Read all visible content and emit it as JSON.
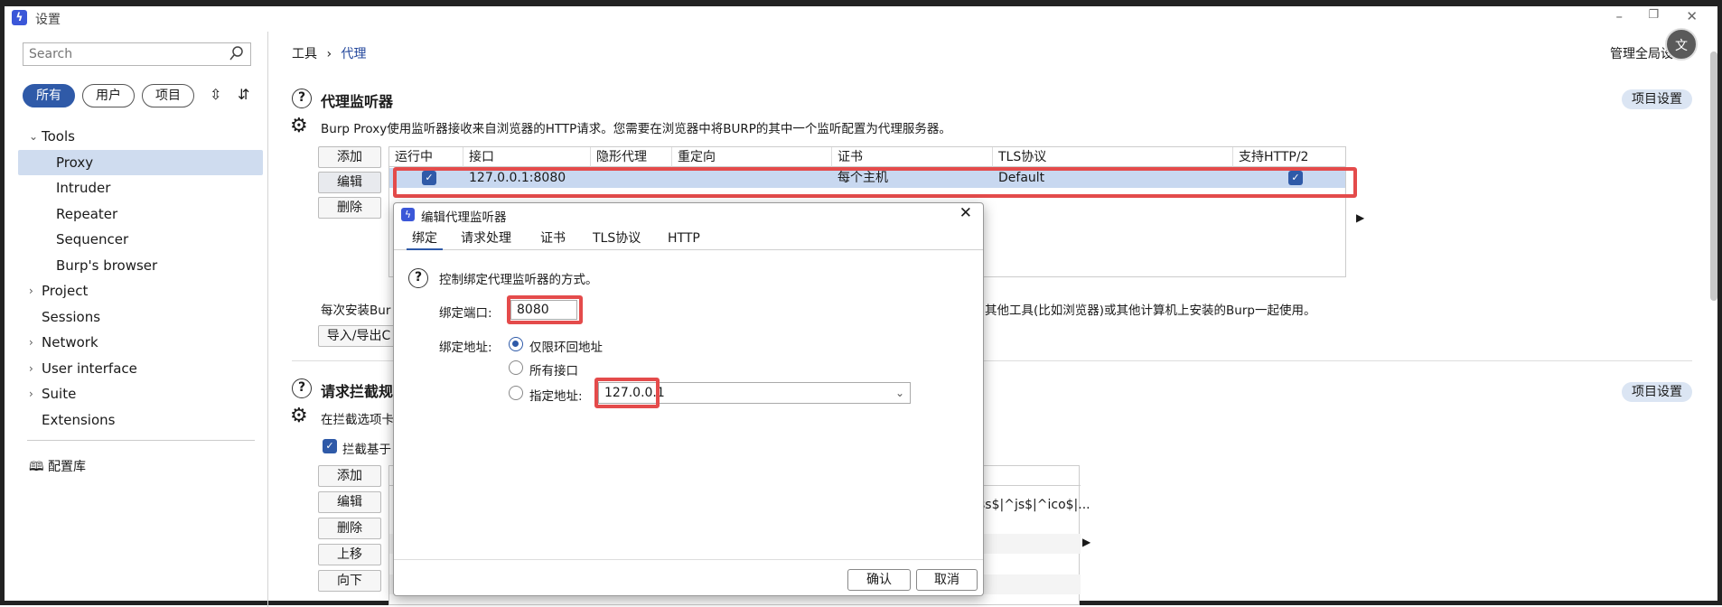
{
  "window": {
    "title": "设置",
    "app_icon": "burp-lightning-icon"
  },
  "sidebar": {
    "search_placeholder": "Search",
    "filters": [
      "所有",
      "用户",
      "项目"
    ],
    "tree": [
      {
        "label": "Tools",
        "expanded": true
      },
      {
        "label": "Proxy",
        "selected": true
      },
      {
        "label": "Intruder"
      },
      {
        "label": "Repeater"
      },
      {
        "label": "Sequencer"
      },
      {
        "label": "Burp's browser"
      },
      {
        "label": "Project",
        "expanded": false
      },
      {
        "label": "Sessions"
      },
      {
        "label": "Network",
        "expanded": false
      },
      {
        "label": "User interface",
        "expanded": false
      },
      {
        "label": "Suite",
        "expanded": false
      },
      {
        "label": "Extensions"
      }
    ],
    "library": "配置库"
  },
  "header": {
    "crumb1": "工具",
    "crumb_sep": "›",
    "crumb2": "代理",
    "global_settings": "管理全局设置",
    "avatar_text": "文"
  },
  "proxy_listeners": {
    "title": "代理监听器",
    "project_settings": "项目设置",
    "description": "Burp Proxy使用监听器接收来自浏览器的HTTP请求。您需要在浏览器中将BURP的其中一个监听配置为代理服务器。",
    "buttons": [
      "添加",
      "编辑",
      "删除"
    ],
    "columns": [
      "运行中",
      "接口",
      "隐形代理",
      "重定向",
      "证书",
      "TLS协议",
      "支持HTTP/2"
    ],
    "row": {
      "running": true,
      "interface": "127.0.0.1:8080",
      "invisible": "",
      "redirect": "",
      "cert": "每个主机",
      "tls": "Default",
      "http2": true
    },
    "note_left": "每次安装Bur",
    "note_right": "其他工具(比如浏览器)或其他计算机上安装的Burp一起使用。",
    "import_export": "导入/导出C"
  },
  "intercept_rules": {
    "title": "请求拦截规",
    "project_settings": "项目设置",
    "description": "在拦截选项卡",
    "checkbox_label": "拦截基于",
    "buttons": [
      "添加",
      "编辑",
      "删除",
      "上移",
      "向下"
    ],
    "row_partial": "ss$|^js$|^ico$|..."
  },
  "dialog": {
    "title": "编辑代理监听器",
    "tabs": [
      "绑定",
      "请求处理",
      "证书",
      "TLS协议",
      "HTTP"
    ],
    "active_tab": "绑定",
    "help_text": "控制绑定代理监听器的方式。",
    "port_label": "绑定端口:",
    "port_value": "8080",
    "address_label": "绑定地址:",
    "options": [
      "仅限环回地址",
      "所有接口",
      "指定地址:"
    ],
    "selected_option": "仅限环回地址",
    "specific_address": "127.0.0.1",
    "ok": "确认",
    "cancel": "取消"
  },
  "colors": {
    "accent": "#2f5aa8",
    "highlight_row": "#c8d8f0",
    "annotation_red": "#e44b4b"
  }
}
